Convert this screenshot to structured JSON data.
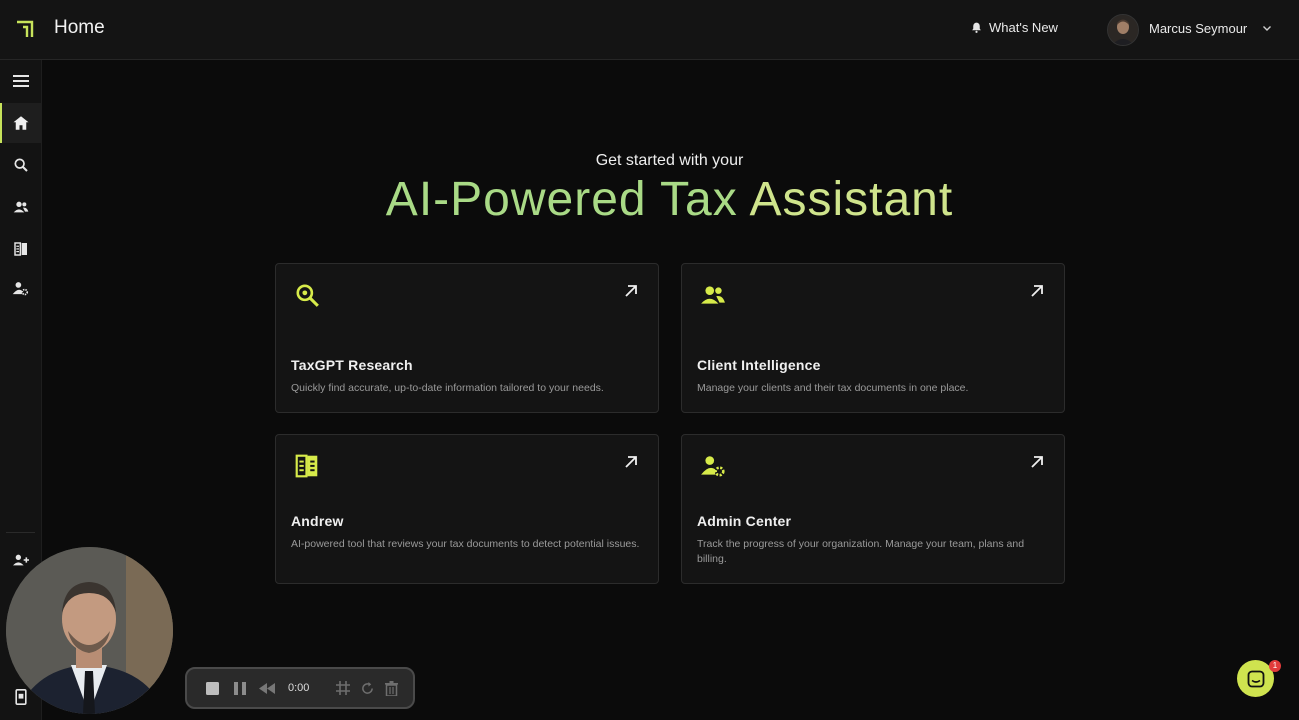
{
  "header": {
    "title": "Home",
    "whats_new": "What's New",
    "user_name": "Marcus Seymour"
  },
  "hero": {
    "subtitle": "Get started with your",
    "title_main": "AI-Powered Tax ",
    "title_last": "Assistant"
  },
  "cards": [
    {
      "title": "TaxGPT Research",
      "description": "Quickly find accurate, up-to-date information tailored to your needs.",
      "icon": "search-icon"
    },
    {
      "title": "Client Intelligence",
      "description": "Manage your clients and their tax documents in one place.",
      "icon": "users-icon"
    },
    {
      "title": "Andrew",
      "description": "AI-powered tool that reviews your tax documents to detect potential issues.",
      "icon": "document-review-icon"
    },
    {
      "title": "Admin Center",
      "description": "Track the progress of your organization. Manage your team, plans and billing.",
      "icon": "user-settings-icon"
    }
  ],
  "recorder": {
    "time": "0:00"
  },
  "chat": {
    "badge": "1"
  },
  "colors": {
    "accent": "#c7e35b",
    "hero_gradient_start": "#a9da86",
    "chat": "#cfe34f"
  }
}
